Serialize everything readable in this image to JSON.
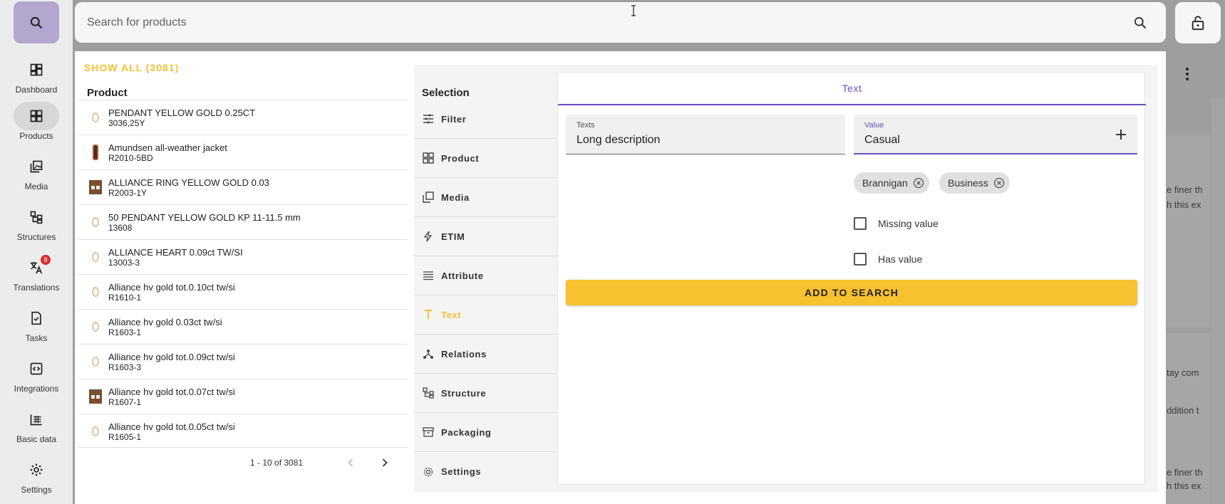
{
  "rail": {
    "items": [
      {
        "label": "Dashboard",
        "icon": "dashboard-icon"
      },
      {
        "label": "Products",
        "icon": "products-icon"
      },
      {
        "label": "Media",
        "icon": "media-icon"
      },
      {
        "label": "Structures",
        "icon": "structures-icon"
      },
      {
        "label": "Translations",
        "icon": "translate-icon",
        "badge": "8"
      },
      {
        "label": "Tasks",
        "icon": "tasks-icon"
      },
      {
        "label": "Integrations",
        "icon": "integrations-icon"
      },
      {
        "label": "Basic data",
        "icon": "basic-data-icon"
      },
      {
        "label": "Settings",
        "icon": "settings-icon"
      }
    ]
  },
  "search": {
    "placeholder": "Search for products",
    "value": ""
  },
  "products": {
    "show_all": "SHOW ALL (3081)",
    "header": "Product",
    "rows": [
      {
        "name": "PENDANT YELLOW GOLD 0.25CT",
        "code": "3036,25Y"
      },
      {
        "name": "Amundsen all-weather jacket",
        "code": "R2010-5BD"
      },
      {
        "name": "ALLIANCE RING YELLOW GOLD 0.03",
        "code": "R2003-1Y"
      },
      {
        "name": "50 PENDANT YELLOW GOLD KP 11-11.5 mm",
        "code": "13608"
      },
      {
        "name": "ALLIANCE HEART 0.09ct TW/SI",
        "code": "13003-3"
      },
      {
        "name": "Alliance hv gold tot.0.10ct tw/si",
        "code": "R1610-1"
      },
      {
        "name": "Alliance hv gold 0.03ct tw/si",
        "code": "R1603-1"
      },
      {
        "name": "Alliance hv gold tot.0.09ct tw/si",
        "code": "R1603-3"
      },
      {
        "name": "Alliance hv gold tot.0.07ct tw/si",
        "code": "R1607-1"
      },
      {
        "name": "Alliance hv gold tot.0.05ct tw/si",
        "code": "R1605-1"
      }
    ],
    "pager": "1 - 10 of 3081"
  },
  "selection": {
    "header": "Selection",
    "items": [
      "Filter",
      "Product",
      "Media",
      "ETIM",
      "Attribute",
      "Text",
      "Relations",
      "Structure",
      "Packaging",
      "Settings"
    ],
    "active": "Text"
  },
  "text_panel": {
    "tab": "Text",
    "texts_label": "Texts",
    "texts_value": "Long description",
    "value_label": "Value",
    "value_value": "Casual",
    "chips": [
      "Brannigan",
      "Business"
    ],
    "missing_value": "Missing value",
    "has_value": "Has value",
    "add_button": "ADD TO SEARCH"
  },
  "background": {
    "snippets": [
      "e finer th",
      "h this ex",
      "tay com",
      "ddition t",
      "e finer th",
      "h this ex"
    ]
  },
  "colors": {
    "accent": "#f7c131",
    "primary": "#6a4fc0",
    "badge": "#d32f2f"
  }
}
